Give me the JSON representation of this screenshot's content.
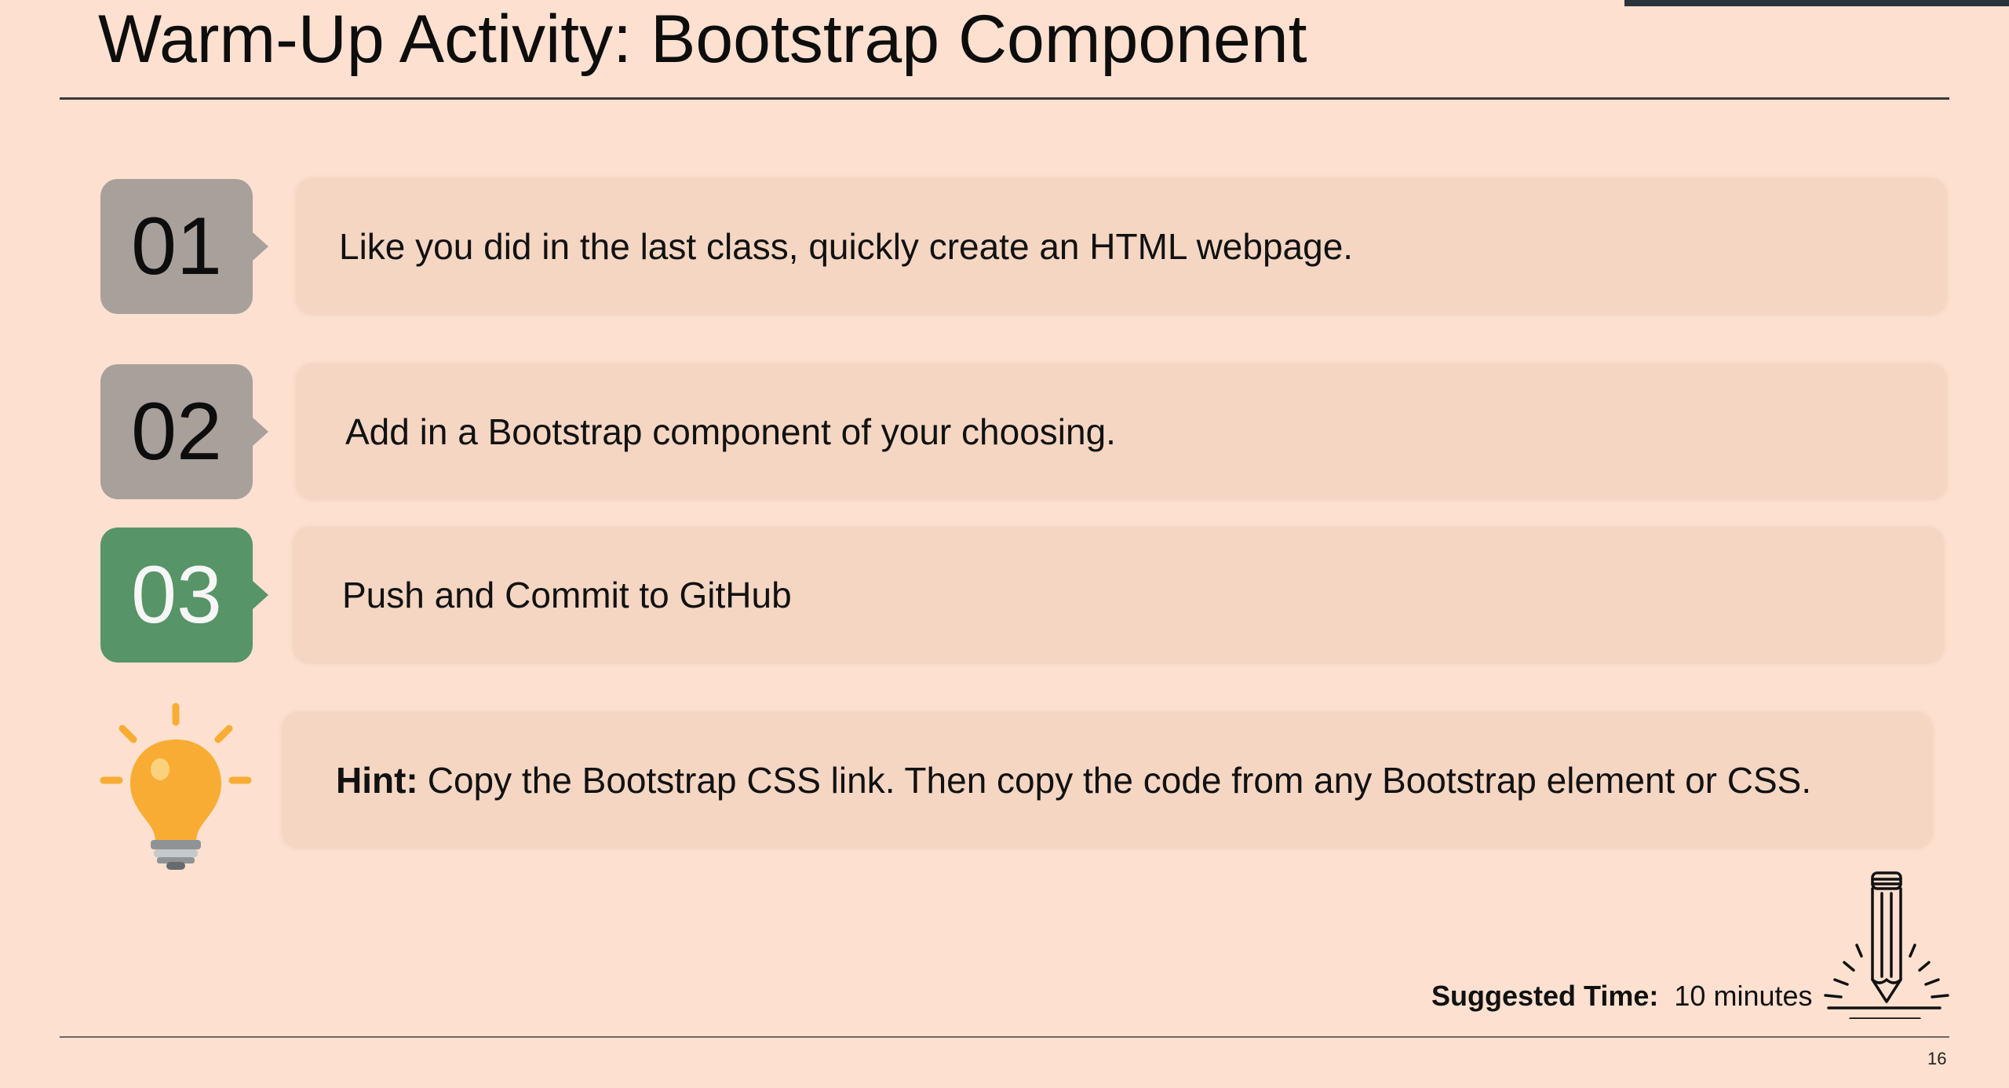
{
  "slide": {
    "title": "Warm-Up Activity: Bootstrap Component",
    "steps": [
      {
        "number": "01",
        "text": "Like you did in the last class, quickly create an HTML webpage."
      },
      {
        "number": "02",
        "text": "Add in a Bootstrap component of your choosing."
      },
      {
        "number": "03",
        "text": "Push and Commit to GitHub"
      }
    ],
    "hint": {
      "label": "Hint:",
      "text": "Copy the Bootstrap CSS link. Then copy the code from any Bootstrap element or CSS.",
      "icon": "lightbulb-icon"
    },
    "suggested_time": {
      "label": "Suggested Time:",
      "value": "10 minutes",
      "icon": "pencil-icon"
    },
    "page_number": "16"
  },
  "colors": {
    "background": "#fde0cf",
    "step_box": "#a8a09b",
    "step_box_active": "#579468",
    "text_box": "#f4d6c3",
    "bulb": "#f9ac33"
  }
}
